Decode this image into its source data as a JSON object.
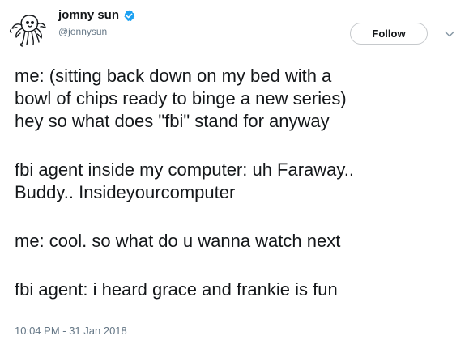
{
  "author": {
    "display_name": "jomny sun",
    "handle": "@jonnysun",
    "verified": true,
    "avatar_icon": "doodle-alien-avatar"
  },
  "actions": {
    "follow_label": "Follow",
    "menu_icon": "chevron-down-icon"
  },
  "tweet": {
    "paragraphs": [
      {
        "lines": [
          "me: (sitting back down on my bed with a",
          "bowl of chips ready to binge a new series)",
          "hey so what does \"fbi\" stand for anyway"
        ]
      },
      {
        "lines": [
          "fbi agent inside my computer: uh Faraway..",
          "Buddy.. Insideyourcomputer"
        ]
      },
      {
        "lines": [
          "me: cool. so what do u wanna watch next"
        ]
      },
      {
        "lines": [
          "fbi agent: i heard grace and frankie is fun"
        ]
      }
    ],
    "timestamp": "10:04 PM - 31 Jan 2018"
  },
  "colors": {
    "text": "#14171a",
    "secondary": "#657786",
    "verified": "#1da1f2",
    "button_border": "#c6c9cc"
  }
}
